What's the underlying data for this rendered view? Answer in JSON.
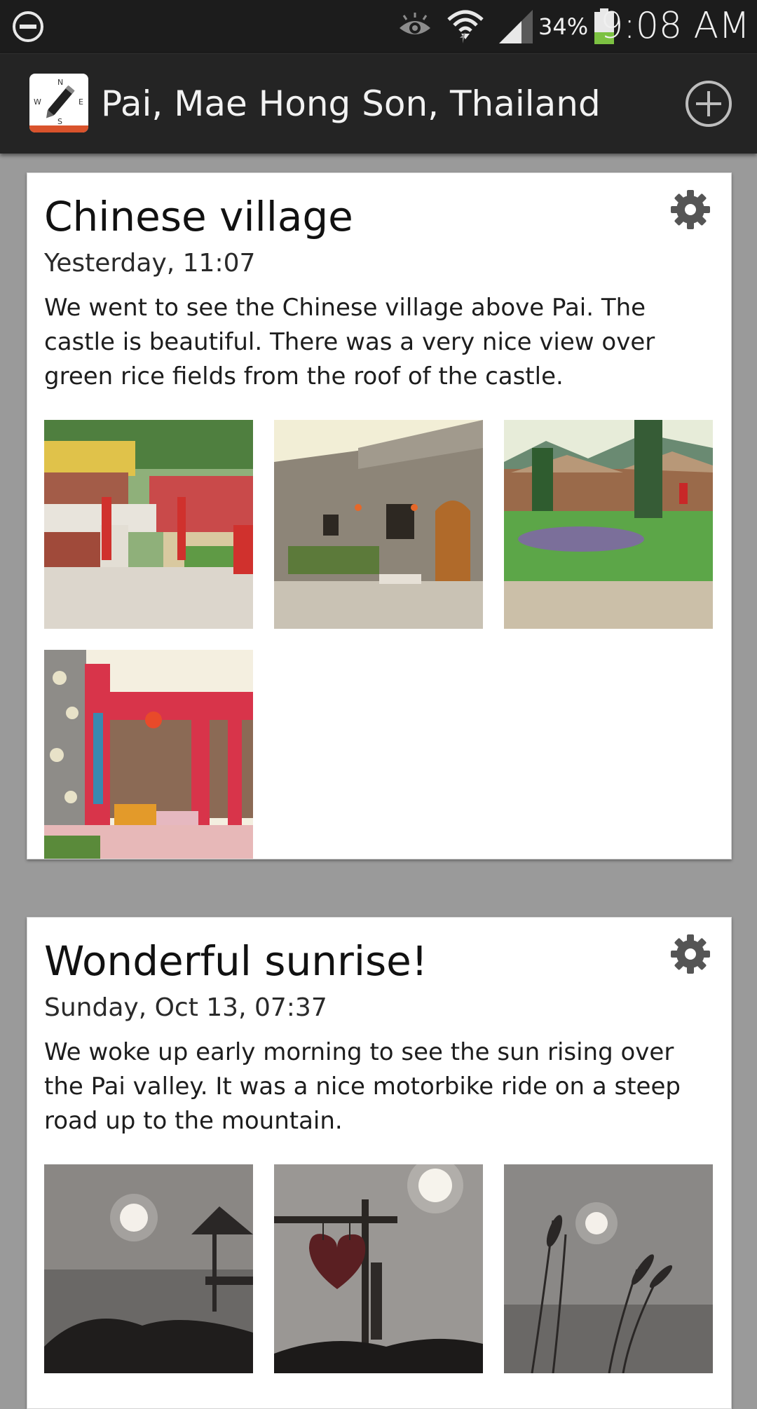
{
  "status_bar": {
    "battery_percent": "34%",
    "time": "9:08 AM",
    "icons": [
      "do-not-disturb-icon",
      "eye-icon",
      "wifi-icon",
      "signal-icon",
      "battery-icon"
    ]
  },
  "action_bar": {
    "title": "Pai, Mae Hong Son, Thailand",
    "icons": [
      "app-compass-icon",
      "add-circle-icon"
    ]
  },
  "entries": [
    {
      "title": "Chinese village",
      "date": "Yesterday, 11:07",
      "text": "We went to see the Chinese village above Pai. The castle is beautiful. There was a very nice view over green rice fields from the roof of the castle.",
      "photos": [
        "photo-castle-rooftop",
        "photo-castle-wall",
        "photo-village-lawn",
        "photo-red-pavilion"
      ]
    },
    {
      "title": "Wonderful sunrise!",
      "date": "Sunday, Oct 13, 07:37",
      "text": "We woke up early morning to see the sun rising over the Pai valley. It was a nice motorbike ride on a steep road up to the mountain.",
      "photos": [
        "photo-sunrise-hut",
        "photo-sunrise-heart-sign",
        "photo-sunrise-grass"
      ]
    }
  ],
  "colors": {
    "status_bar_bg": "#1c1c1c",
    "action_bar_bg": "#242424",
    "feed_bg": "#9a9a9a",
    "card_bg": "#ffffff",
    "accent": "#d9532c",
    "battery_level": "#7cc142"
  }
}
